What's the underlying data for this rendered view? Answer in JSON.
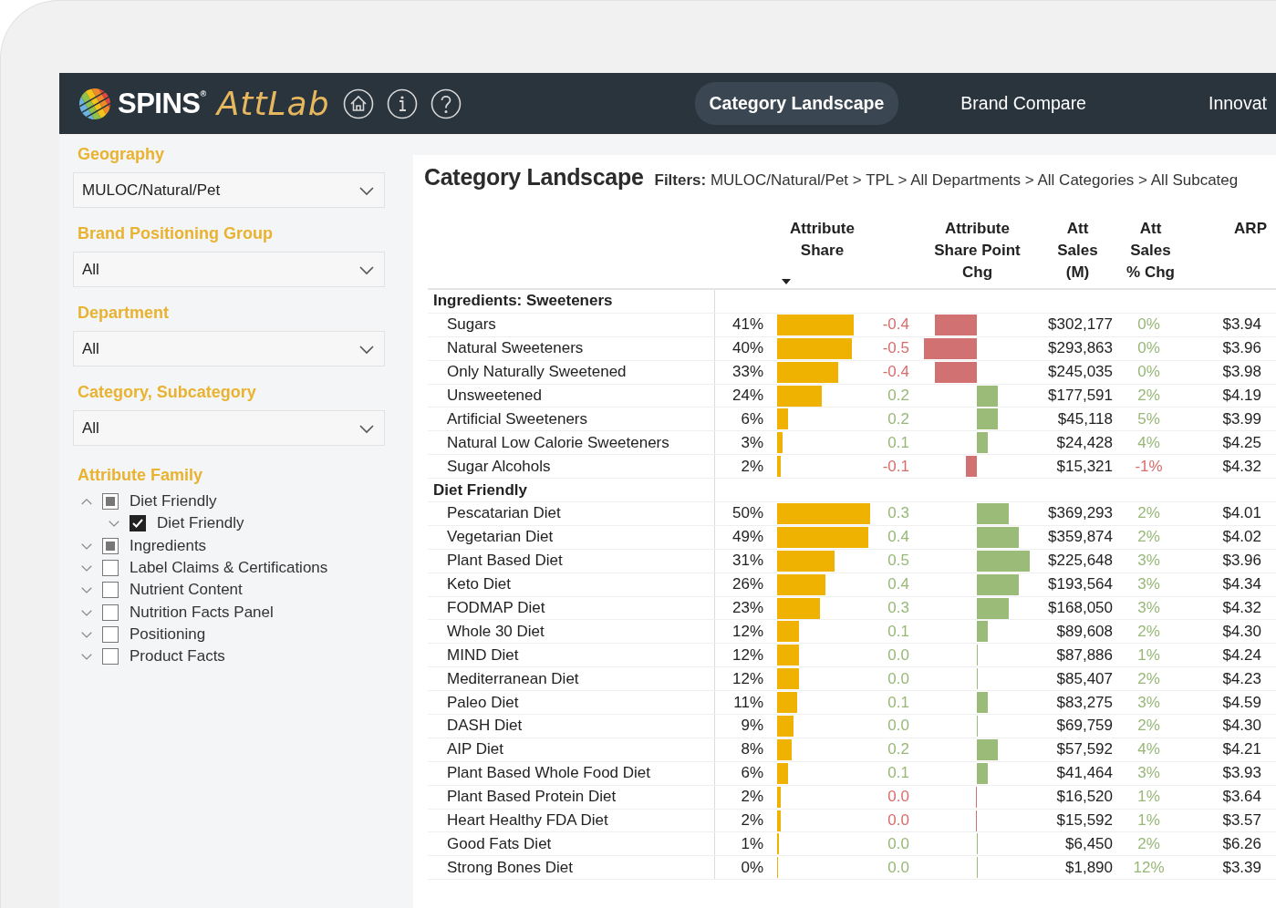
{
  "header": {
    "brand": "SPINS",
    "brand_mark": "®",
    "product": "AttLab",
    "tabs": [
      {
        "label": "Category Landscape",
        "selected": true
      },
      {
        "label": "Brand Compare",
        "selected": false
      },
      {
        "label": "Innovat",
        "selected": false
      }
    ]
  },
  "sidebar": {
    "filters": [
      {
        "label": "Geography",
        "value": "MULOC/Natural/Pet"
      },
      {
        "label": "Brand Positioning Group",
        "value": "All"
      },
      {
        "label": "Department",
        "value": "All"
      },
      {
        "label": "Category, Subcategory",
        "value": "All"
      }
    ],
    "attribute_family": {
      "label": "Attribute Family",
      "items": [
        {
          "label": "Diet Friendly",
          "expanded": true,
          "checked": false,
          "partial": true,
          "children": [
            {
              "label": "Diet Friendly",
              "expanded": false,
              "checked": true,
              "partial": false
            }
          ]
        },
        {
          "label": "Ingredients",
          "expanded": false,
          "checked": false,
          "partial": true
        },
        {
          "label": "Label Claims & Certifications",
          "expanded": false,
          "checked": false,
          "partial": false
        },
        {
          "label": "Nutrient Content",
          "expanded": false,
          "checked": false,
          "partial": false
        },
        {
          "label": "Nutrition Facts Panel",
          "expanded": false,
          "checked": false,
          "partial": false
        },
        {
          "label": "Positioning",
          "expanded": false,
          "checked": false,
          "partial": false
        },
        {
          "label": "Product Facts",
          "expanded": false,
          "checked": false,
          "partial": false
        }
      ]
    }
  },
  "report": {
    "title": "Category Landscape",
    "filters": "**Filters:** MULOC/Natural/Pet > TPL > All Departments > All Categories > All Subcateg",
    "columns": [
      {
        "label": "Attribute Share",
        "sorted": true
      },
      {
        "label": "Attribute Share Point Chg",
        "sorted": false
      },
      {
        "label": "Att Sales (M)",
        "sorted": false
      },
      {
        "label": "Att Sales % Chg",
        "sorted": false
      },
      {
        "label": "ARP",
        "sorted": false
      }
    ],
    "groups": [
      {
        "name": "Ingredients: Sweeteners",
        "rows": [
          {
            "name": "Sugars",
            "share": "41%",
            "share_chg": {
              "text": "-0.4",
              "negative": true
            },
            "sales": "$302,177",
            "sales_chg": {
              "text": "0%",
              "negative": false
            },
            "arp": "$3.94"
          },
          {
            "name": "Natural Sweeteners",
            "share": "40%",
            "share_chg": {
              "text": "-0.5",
              "negative": true
            },
            "sales": "$293,863",
            "sales_chg": {
              "text": "0%",
              "negative": false
            },
            "arp": "$3.96"
          },
          {
            "name": "Only Naturally Sweetened",
            "share": "33%",
            "share_chg": {
              "text": "-0.4",
              "negative": true
            },
            "sales": "$245,035",
            "sales_chg": {
              "text": "0%",
              "negative": false
            },
            "arp": "$3.98"
          },
          {
            "name": "Unsweetened",
            "share": "24%",
            "share_chg": {
              "text": "0.2",
              "negative": false
            },
            "sales": "$177,591",
            "sales_chg": {
              "text": "2%",
              "negative": false
            },
            "arp": "$4.19"
          },
          {
            "name": "Artificial Sweeteners",
            "share": "6%",
            "share_chg": {
              "text": "0.2",
              "negative": false
            },
            "sales": "$45,118",
            "sales_chg": {
              "text": "5%",
              "negative": false
            },
            "arp": "$3.99"
          },
          {
            "name": "Natural Low Calorie Sweeteners",
            "share": "3%",
            "share_chg": {
              "text": "0.1",
              "negative": false
            },
            "sales": "$24,428",
            "sales_chg": {
              "text": "4%",
              "negative": false
            },
            "arp": "$4.25"
          },
          {
            "name": "Sugar Alcohols",
            "share": "2%",
            "share_chg": {
              "text": "-0.1",
              "negative": true
            },
            "sales": "$15,321",
            "sales_chg": {
              "text": "-1%",
              "negative": true
            },
            "arp": "$4.32"
          }
        ]
      },
      {
        "name": "Diet Friendly",
        "rows": [
          {
            "name": "Pescatarian Diet",
            "share": "50%",
            "share_chg": {
              "text": "0.3",
              "negative": false
            },
            "sales": "$369,293",
            "sales_chg": {
              "text": "2%",
              "negative": false
            },
            "arp": "$4.01"
          },
          {
            "name": "Vegetarian Diet",
            "share": "49%",
            "share_chg": {
              "text": "0.4",
              "negative": false
            },
            "sales": "$359,874",
            "sales_chg": {
              "text": "2%",
              "negative": false
            },
            "arp": "$4.02"
          },
          {
            "name": "Plant Based Diet",
            "share": "31%",
            "share_chg": {
              "text": "0.5",
              "negative": false
            },
            "sales": "$225,648",
            "sales_chg": {
              "text": "3%",
              "negative": false
            },
            "arp": "$3.96"
          },
          {
            "name": "Keto Diet",
            "share": "26%",
            "share_chg": {
              "text": "0.4",
              "negative": false
            },
            "sales": "$193,564",
            "sales_chg": {
              "text": "3%",
              "negative": false
            },
            "arp": "$4.34"
          },
          {
            "name": "FODMAP Diet",
            "share": "23%",
            "share_chg": {
              "text": "0.3",
              "negative": false
            },
            "sales": "$168,050",
            "sales_chg": {
              "text": "3%",
              "negative": false
            },
            "arp": "$4.32"
          },
          {
            "name": "Whole 30 Diet",
            "share": "12%",
            "share_chg": {
              "text": "0.1",
              "negative": false
            },
            "sales": "$89,608",
            "sales_chg": {
              "text": "2%",
              "negative": false
            },
            "arp": "$4.30"
          },
          {
            "name": "MIND Diet",
            "share": "12%",
            "share_chg": {
              "text": "0.0",
              "negative": false
            },
            "sales": "$87,886",
            "sales_chg": {
              "text": "1%",
              "negative": false
            },
            "arp": "$4.24"
          },
          {
            "name": "Mediterranean Diet",
            "share": "12%",
            "share_chg": {
              "text": "0.0",
              "negative": false
            },
            "sales": "$85,407",
            "sales_chg": {
              "text": "2%",
              "negative": false
            },
            "arp": "$4.23"
          },
          {
            "name": "Paleo Diet",
            "share": "11%",
            "share_chg": {
              "text": "0.1",
              "negative": false
            },
            "sales": "$83,275",
            "sales_chg": {
              "text": "3%",
              "negative": false
            },
            "arp": "$4.59"
          },
          {
            "name": "DASH Diet",
            "share": "9%",
            "share_chg": {
              "text": "0.0",
              "negative": false
            },
            "sales": "$69,759",
            "sales_chg": {
              "text": "2%",
              "negative": false
            },
            "arp": "$4.30"
          },
          {
            "name": "AIP Diet",
            "share": "8%",
            "share_chg": {
              "text": "0.2",
              "negative": false
            },
            "sales": "$57,592",
            "sales_chg": {
              "text": "4%",
              "negative": false
            },
            "arp": "$4.21"
          },
          {
            "name": "Plant Based Whole Food Diet",
            "share": "6%",
            "share_chg": {
              "text": "0.1",
              "negative": false
            },
            "sales": "$41,464",
            "sales_chg": {
              "text": "3%",
              "negative": false
            },
            "arp": "$3.93"
          },
          {
            "name": "Plant Based Protein Diet",
            "share": "2%",
            "share_chg": {
              "text": "0.0",
              "negative": true
            },
            "sales": "$16,520",
            "sales_chg": {
              "text": "1%",
              "negative": false
            },
            "arp": "$3.64"
          },
          {
            "name": "Heart Healthy FDA Diet",
            "share": "2%",
            "share_chg": {
              "text": "0.0",
              "negative": true
            },
            "sales": "$15,592",
            "sales_chg": {
              "text": "1%",
              "negative": false
            },
            "arp": "$3.57"
          },
          {
            "name": "Good Fats Diet",
            "share": "1%",
            "share_chg": {
              "text": "0.0",
              "negative": false
            },
            "sales": "$6,450",
            "sales_chg": {
              "text": "2%",
              "negative": false
            },
            "arp": "$6.26"
          },
          {
            "name": "Strong Bones Diet",
            "share": "0%",
            "share_chg": {
              "text": "0.0",
              "negative": false
            },
            "sales": "$1,890",
            "sales_chg": {
              "text": "12%",
              "negative": false
            },
            "arp": "$3.39"
          }
        ]
      }
    ]
  }
}
